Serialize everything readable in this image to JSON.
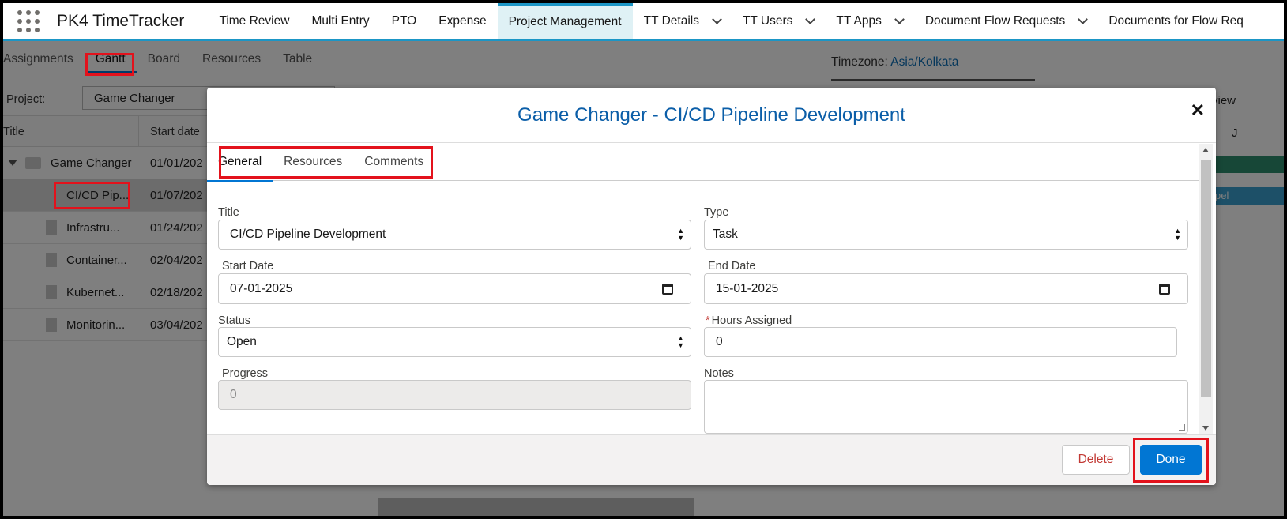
{
  "app": {
    "name": "PK4 TimeTracker"
  },
  "nav": {
    "items": [
      {
        "label": "Time Review",
        "dropdown": false,
        "active": false
      },
      {
        "label": "Multi Entry",
        "dropdown": false,
        "active": false
      },
      {
        "label": "PTO",
        "dropdown": false,
        "active": false
      },
      {
        "label": "Expense",
        "dropdown": false,
        "active": false
      },
      {
        "label": "Project Management",
        "dropdown": false,
        "active": true
      },
      {
        "label": "TT Details",
        "dropdown": true,
        "active": false
      },
      {
        "label": "TT Users",
        "dropdown": true,
        "active": false
      },
      {
        "label": "TT Apps",
        "dropdown": true,
        "active": false
      },
      {
        "label": "Document Flow Requests",
        "dropdown": true,
        "active": false
      },
      {
        "label": "Documents for Flow Req",
        "dropdown": false,
        "active": false
      }
    ]
  },
  "page": {
    "subtabs": [
      "Assignments",
      "Gantt",
      "Board",
      "Resources",
      "Table"
    ],
    "selected_subtab": "Gantt",
    "timezone_label": "Timezone:",
    "timezone_value": "Asia/Kolkata",
    "project_label": "Project:",
    "project_value": "Game Changer",
    "grid_headers": {
      "title": "Title",
      "start": "Start date"
    },
    "rows": [
      {
        "name": "Game Changer",
        "date": "01/01/202",
        "type": "folder"
      },
      {
        "name": "CI/CD Pip...",
        "date": "01/07/202",
        "type": "task",
        "selected": true
      },
      {
        "name": "Infrastru...",
        "date": "01/24/202",
        "type": "task"
      },
      {
        "name": "Container...",
        "date": "02/04/202",
        "type": "task"
      },
      {
        "name": "Kubernet...",
        "date": "02/18/202",
        "type": "task"
      },
      {
        "name": "Monitorin...",
        "date": "03/04/202",
        "type": "task"
      }
    ],
    "right_partial_view": "view",
    "right_partial_j": "J",
    "right_partial_bar": "pel"
  },
  "modal": {
    "title": "Game Changer - CI/CD Pipeline Development",
    "close_symbol": "✕",
    "tabs": [
      "General",
      "Resources",
      "Comments"
    ],
    "selected_tab": "General",
    "fields": {
      "title": {
        "label": "Title",
        "value": "CI/CD Pipeline Development"
      },
      "type": {
        "label": "Type",
        "value": "Task"
      },
      "start_date": {
        "label": "Start Date",
        "value": "07-01-2025"
      },
      "end_date": {
        "label": "End Date",
        "value": "15-01-2025"
      },
      "status": {
        "label": "Status",
        "value": "Open"
      },
      "hours": {
        "label": "Hours Assigned",
        "value": "0",
        "required_mark": "*"
      },
      "progress": {
        "label": "Progress",
        "value": "0"
      },
      "notes": {
        "label": "Notes",
        "value": ""
      }
    },
    "buttons": {
      "delete": "Delete",
      "done": "Done"
    }
  },
  "colors": {
    "accent": "#0176d3",
    "nav_border": "#1b96c6",
    "highlight_box": "#e3121c",
    "title_blue": "#0b5ea8"
  }
}
